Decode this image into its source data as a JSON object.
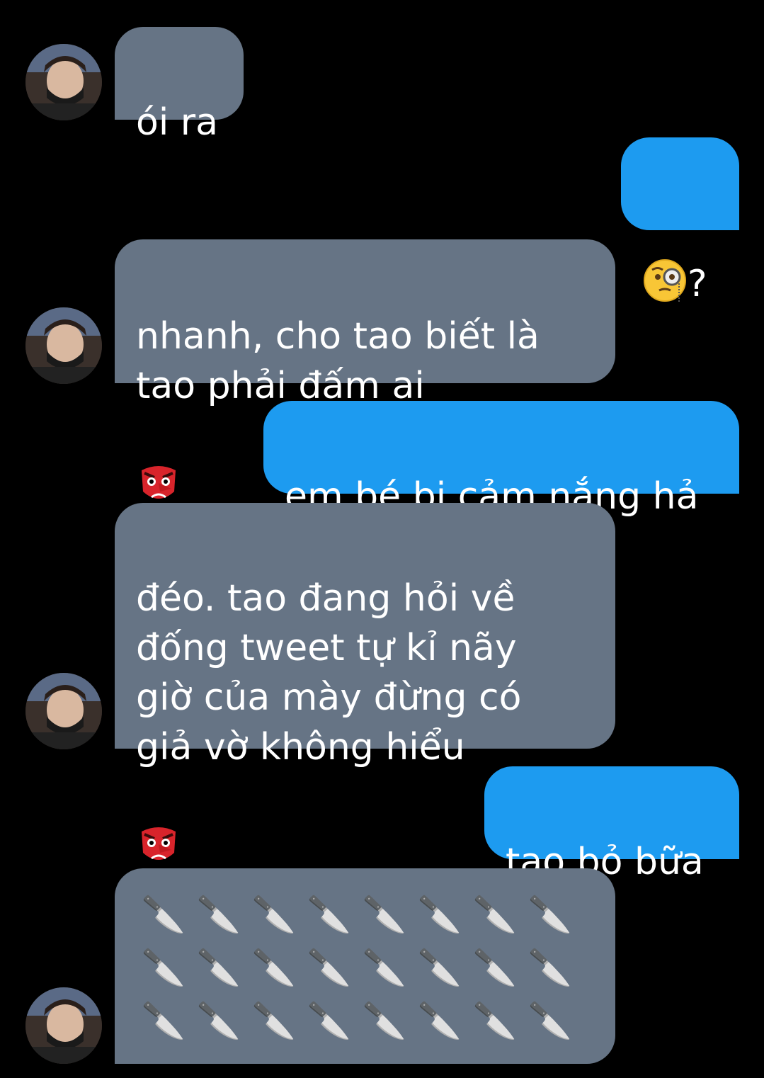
{
  "messages": [
    {
      "side": "in",
      "text": "ói ra"
    },
    {
      "side": "out",
      "text": "?",
      "emoji_before": "face-with-monocle"
    },
    {
      "side": "in",
      "text": "nhanh, cho tao biết là\ntao phải đấm ai",
      "emoji_after": "goblin"
    },
    {
      "side": "out",
      "text": "em bé bị cảm nắng hả"
    },
    {
      "side": "in",
      "text": "đéo. tao đang hỏi về\nđống tweet tự kỉ nãy\ngiờ của mày đừng có\ngiả vờ không hiểu",
      "emoji_after": "goblin"
    },
    {
      "side": "out",
      "text": "tao bỏ bữa"
    },
    {
      "side": "in",
      "emoji_grid": {
        "glyph": "🔪",
        "icon": "kitchen-knife",
        "rows": 3,
        "cols": 8
      }
    }
  ],
  "colors": {
    "background": "#000000",
    "incoming_bubble": "#667485",
    "outgoing_bubble": "#1d9bf0",
    "text": "#ffffff"
  },
  "icons": {
    "avatar": "contact-avatar-photo",
    "monocle": "face-with-monocle-icon",
    "goblin": "goblin-mask-icon",
    "knife": "kitchen-knife-icon"
  }
}
